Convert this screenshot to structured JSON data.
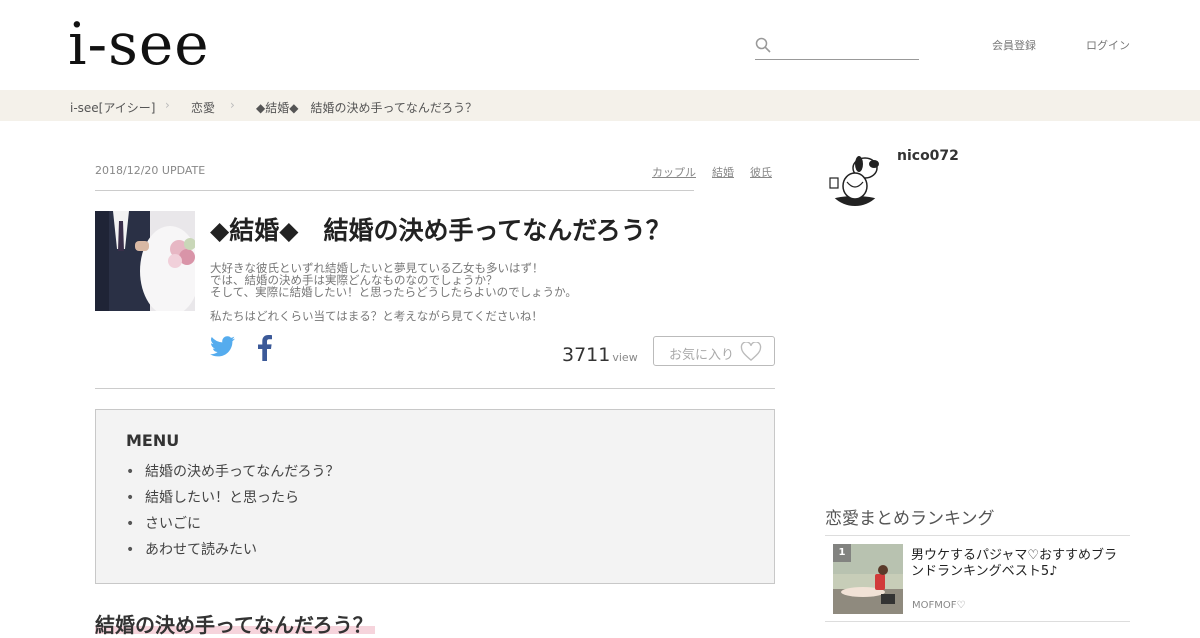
{
  "header": {
    "logo": "i-see",
    "search_placeholder": "",
    "register_label": "会員登録",
    "login_label": "ログイン"
  },
  "breadcrumb": {
    "items": [
      "i-see[アイシー]",
      "恋愛",
      "◆結婚◆　結婚の決め手ってなんだろう？"
    ]
  },
  "article": {
    "date": "2018/12/20 UPDATE",
    "tags": [
      "カップル",
      "結婚",
      "彼氏"
    ],
    "title": "◆結婚◆　結婚の決め手ってなんだろう？",
    "lead_lines": [
      "大好きな彼氏といずれ結婚したいと夢見ている乙女も多いはず！",
      "では、結婚の決め手は実際どんなものなのでしょうか？",
      "そして、実際に結婚したい！と思ったらどうしたらよいのでしょうか。"
    ],
    "lead_last": "私たちはどれくらい当てはまる？と考えながら見てくださいね！",
    "view_count": "3711",
    "view_unit": "view",
    "favorite_label": "お気に入り"
  },
  "menu": {
    "title": "MENU",
    "items": [
      "結婚の決め手ってなんだろう？",
      "結婚したい！と思ったら",
      "さいごに",
      "あわせて読みたい"
    ]
  },
  "section": {
    "heading": "結婚の決め手ってなんだろう？"
  },
  "sidebar": {
    "username": "nico072",
    "ranking_title": "恋愛まとめランキング",
    "ranking": [
      {
        "rank": "1",
        "title": "男ウケするパジャマ♡おすすめブランドランキングベスト5♪",
        "author": "MOFMOF♡"
      }
    ]
  },
  "colors": {
    "breadcrumb_bg": "#f4f1ea",
    "twitter": "#55acee",
    "facebook": "#3b5998",
    "menu_bg": "#f3f3f3",
    "heading_highlight": "#f6d4dc"
  }
}
